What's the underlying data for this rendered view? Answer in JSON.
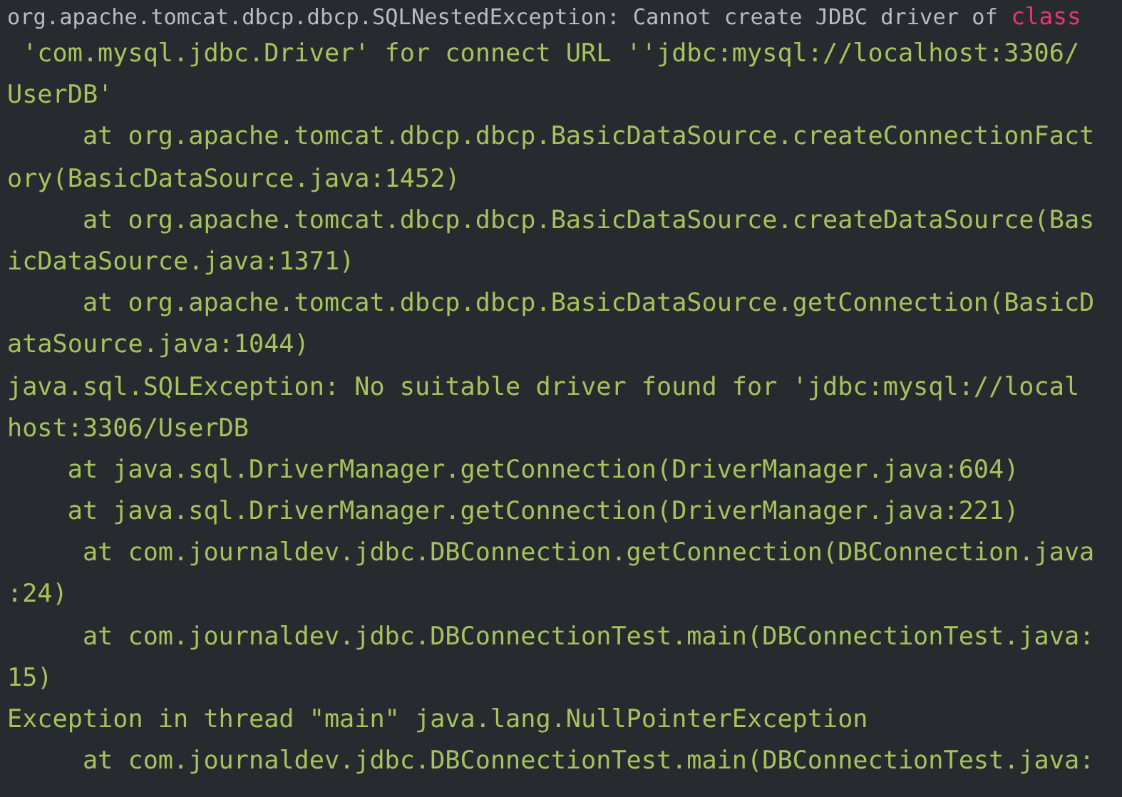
{
  "console_lines": [
    {
      "segments": [
        {
          "kind": "header",
          "text": "org.apache.tomcat.dbcp.dbcp.SQLNestedException: Cannot create JDBC driver of "
        },
        {
          "kind": "keyword",
          "text": "class"
        }
      ]
    },
    {
      "segments": [
        {
          "kind": "text",
          "text": " 'com.mysql.jdbc.Driver' for connect URL ''jdbc:mysql://localhost:3306/"
        }
      ]
    },
    {
      "segments": [
        {
          "kind": "text",
          "text": "UserDB'"
        }
      ]
    },
    {
      "segments": [
        {
          "kind": "text",
          "text": "     at org.apache.tomcat.dbcp.dbcp.BasicDataSource.createConnectionFact"
        }
      ]
    },
    {
      "segments": [
        {
          "kind": "text",
          "text": "ory(BasicDataSource.java:1452)"
        }
      ]
    },
    {
      "segments": [
        {
          "kind": "text",
          "text": "     at org.apache.tomcat.dbcp.dbcp.BasicDataSource.createDataSource(Bas"
        }
      ]
    },
    {
      "segments": [
        {
          "kind": "text",
          "text": "icDataSource.java:1371)"
        }
      ]
    },
    {
      "segments": [
        {
          "kind": "text",
          "text": "     at org.apache.tomcat.dbcp.dbcp.BasicDataSource.getConnection(BasicD"
        }
      ]
    },
    {
      "segments": [
        {
          "kind": "text",
          "text": "ataSource.java:1044)"
        }
      ]
    },
    {
      "segments": [
        {
          "kind": "text",
          "text": "java.sql.SQLException: No suitable driver found for 'jdbc:mysql://local"
        }
      ]
    },
    {
      "segments": [
        {
          "kind": "text",
          "text": "host:3306/UserDB"
        }
      ]
    },
    {
      "segments": [
        {
          "kind": "text",
          "text": "    at java.sql.DriverManager.getConnection(DriverManager.java:604)"
        }
      ]
    },
    {
      "segments": [
        {
          "kind": "text",
          "text": "    at java.sql.DriverManager.getConnection(DriverManager.java:221)"
        }
      ]
    },
    {
      "segments": [
        {
          "kind": "text",
          "text": "     at com.journaldev.jdbc.DBConnection.getConnection(DBConnection.java"
        }
      ]
    },
    {
      "segments": [
        {
          "kind": "text",
          "text": ":24)"
        }
      ]
    },
    {
      "segments": [
        {
          "kind": "text",
          "text": "     at com.journaldev.jdbc.DBConnectionTest.main(DBConnectionTest.java:"
        }
      ]
    },
    {
      "segments": [
        {
          "kind": "text",
          "text": "15)"
        }
      ]
    },
    {
      "segments": [
        {
          "kind": "text",
          "text": "Exception in thread \"main\" java.lang.NullPointerException"
        }
      ]
    },
    {
      "segments": [
        {
          "kind": "text",
          "text": "     at com.journaldev.jdbc.DBConnectionTest.main(DBConnectionTest.java:"
        }
      ]
    }
  ]
}
